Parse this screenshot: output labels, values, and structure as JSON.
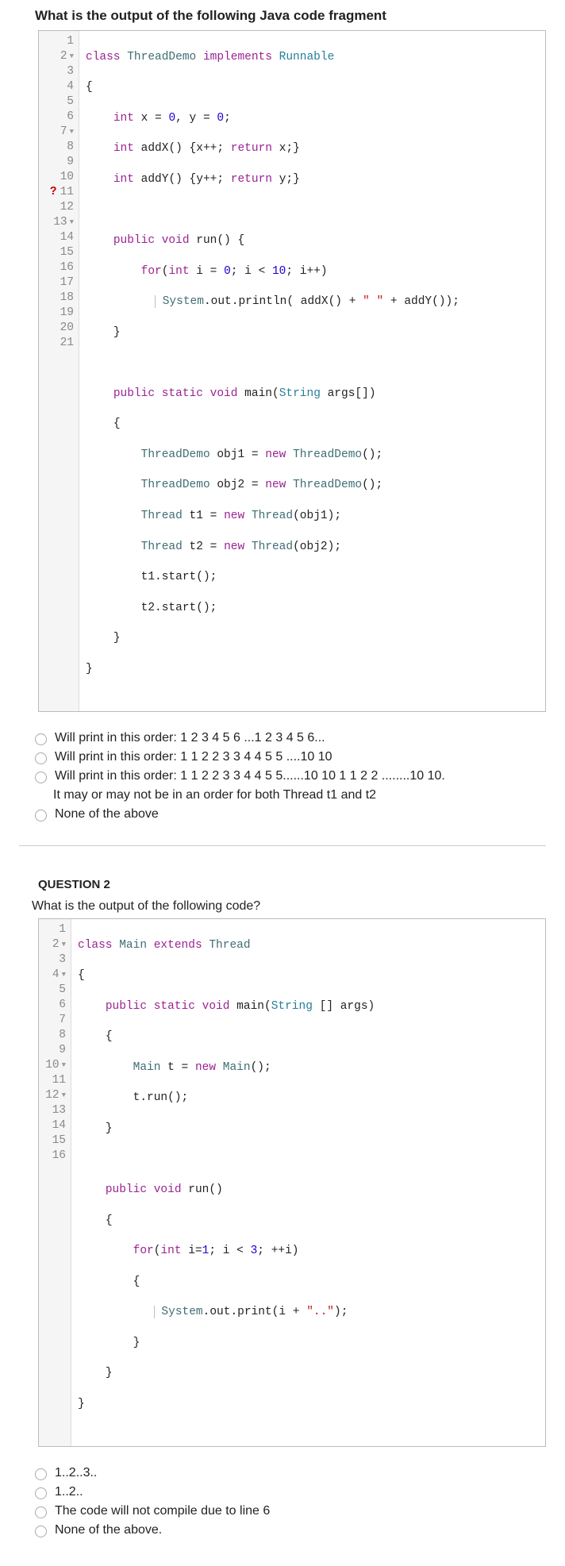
{
  "q1": {
    "title": "What is the output of the following Java code fragment",
    "gutter": [
      {
        "n": "1"
      },
      {
        "n": "2",
        "f": true
      },
      {
        "n": "3"
      },
      {
        "n": "4"
      },
      {
        "n": "5"
      },
      {
        "n": "6"
      },
      {
        "n": "7",
        "f": true
      },
      {
        "n": "8"
      },
      {
        "n": "9"
      },
      {
        "n": "10"
      },
      {
        "n": "11",
        "q": true
      },
      {
        "n": "12"
      },
      {
        "n": "13",
        "f": true
      },
      {
        "n": "14"
      },
      {
        "n": "15"
      },
      {
        "n": "16"
      },
      {
        "n": "17"
      },
      {
        "n": "18"
      },
      {
        "n": "19"
      },
      {
        "n": "20"
      },
      {
        "n": "21"
      }
    ],
    "options": [
      "Will print in this order: 1 2 3 4 5 6 ...1 2 3 4 5 6...",
      "Will print in this order: 1 1 2 2 3 3 4 4 5 5 ....10 10",
      "Will print in this order: 1 1 2 2 3 3 4 4 5 5......10 10 1 1 2 2 ........10 10.",
      "It may or may not be in an order for both Thread t1 and t2",
      "None of the above"
    ]
  },
  "q2": {
    "header": "QUESTION 2",
    "prompt": "What is the output of the following code?",
    "gutter": [
      {
        "n": "1"
      },
      {
        "n": "2",
        "f": true
      },
      {
        "n": "3"
      },
      {
        "n": "4",
        "f": true
      },
      {
        "n": "5"
      },
      {
        "n": "6"
      },
      {
        "n": "7"
      },
      {
        "n": "8"
      },
      {
        "n": "9"
      },
      {
        "n": "10",
        "f": true
      },
      {
        "n": "11"
      },
      {
        "n": "12",
        "f": true
      },
      {
        "n": "13"
      },
      {
        "n": "14"
      },
      {
        "n": "15"
      },
      {
        "n": "16"
      }
    ],
    "options": [
      "1..2..3..",
      "1..2..",
      "The code will not compile due to line 6",
      "None of the above."
    ]
  },
  "tok": {
    "class": "class",
    "implements": "implements",
    "extends": "extends",
    "int": "int",
    "return": "return",
    "public": "public",
    "void": "void",
    "static": "static",
    "for": "for",
    "new": "new",
    "ThreadDemo": "ThreadDemo",
    "Runnable": "Runnable",
    "String": "String",
    "Thread": "Thread",
    "System": "System",
    "Main": "Main",
    "run": "run",
    "main": "main",
    "args": "args",
    "println": "println",
    "print": "print",
    "out": "out",
    "addX": "addX",
    "addY": "addY",
    "obj1": "obj1",
    "obj2": "obj2",
    "t1": "t1",
    "t2": "t2",
    "t": "t",
    "start": "start",
    "x": "x",
    "y": "y",
    "i": "i",
    "n0": "0",
    "n1": "1",
    "n3": "3",
    "n10": "10",
    "s_sp": "\" \"",
    "s_dd": "\"..\"",
    "lb": "{",
    "rb": "}",
    "lp": "(",
    "rp": ")",
    "lbk": "[",
    "rbk": "]",
    "sc": ";",
    "cm": ",",
    "eq": " = ",
    "lt": " < ",
    "pl": " + ",
    "pp": "++",
    "plpl": "++",
    "dot": "."
  }
}
